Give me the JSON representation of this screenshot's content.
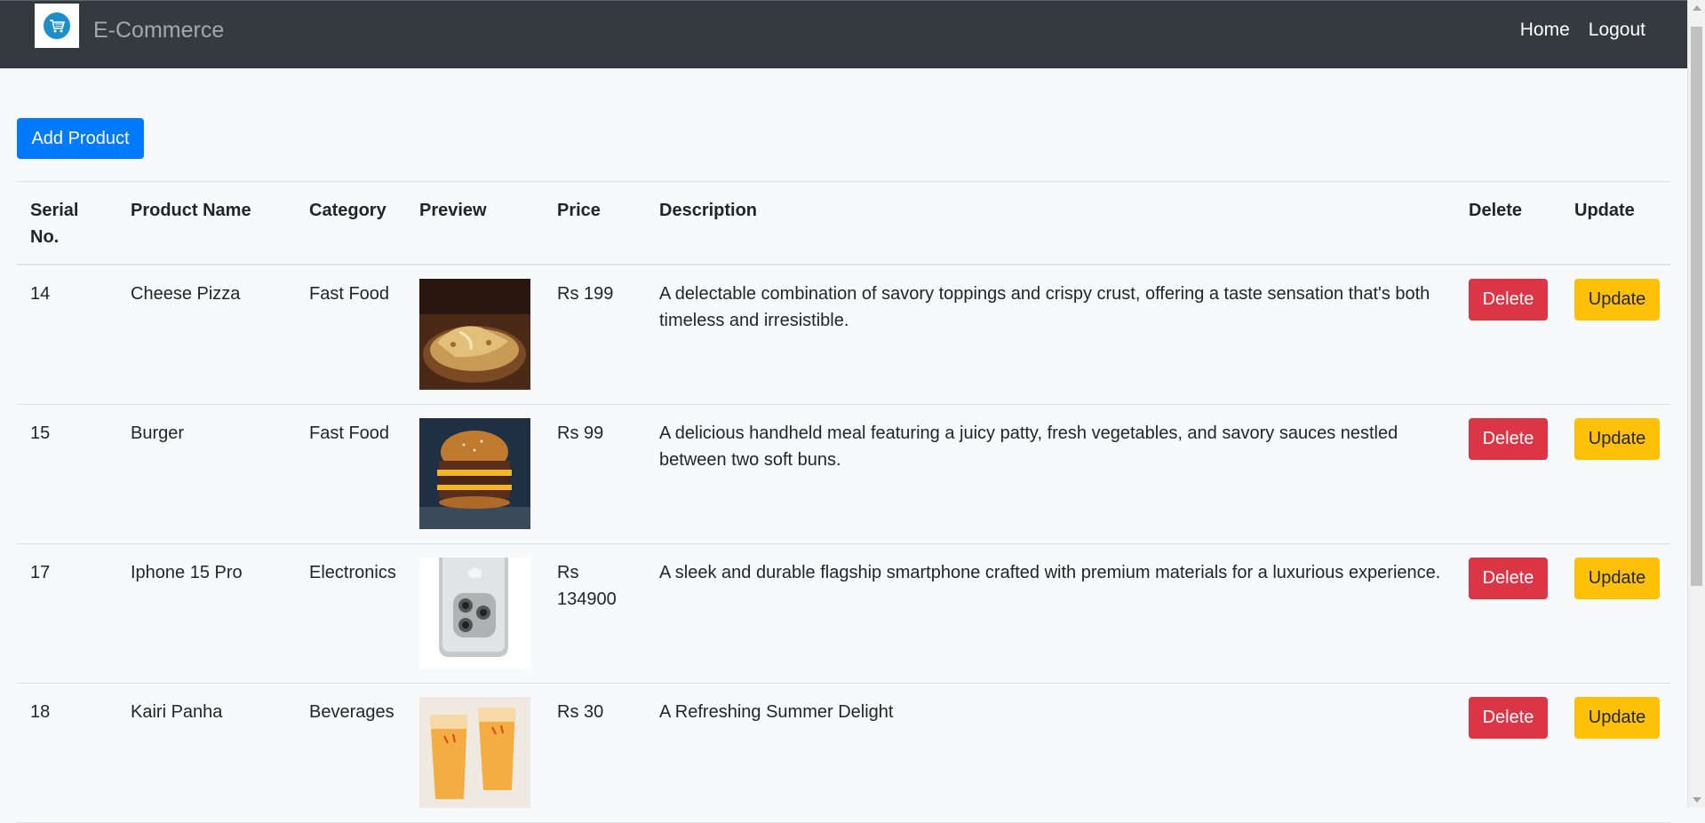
{
  "navbar": {
    "brand": "E-Commerce",
    "links": {
      "home": "Home",
      "logout": "Logout"
    }
  },
  "toolbar": {
    "add_label": "Add Product"
  },
  "table": {
    "headers": {
      "serial": "Serial No.",
      "name": "Product Name",
      "category": "Category",
      "preview": "Preview",
      "price": "Price",
      "description": "Description",
      "delete": "Delete",
      "update": "Update"
    },
    "rows": [
      {
        "serial": "14",
        "name": "Cheese Pizza",
        "category": "Fast Food",
        "preview_icon": "pizza-image",
        "price": "Rs 199",
        "description": "A delectable combination of savory toppings and crispy crust, offering a taste sensation that's both timeless and irresistible.",
        "delete_label": "Delete",
        "update_label": "Update"
      },
      {
        "serial": "15",
        "name": "Burger",
        "category": "Fast Food",
        "preview_icon": "burger-image",
        "price": "Rs 99",
        "description": "A delicious handheld meal featuring a juicy patty, fresh vegetables, and savory sauces nestled between two soft buns.",
        "delete_label": "Delete",
        "update_label": "Update"
      },
      {
        "serial": "17",
        "name": "Iphone 15 Pro",
        "category": "Electronics",
        "preview_icon": "phone-image",
        "price": "Rs 134900",
        "description": "A sleek and durable flagship smartphone crafted with premium materials for a luxurious experience.",
        "delete_label": "Delete",
        "update_label": "Update"
      },
      {
        "serial": "18",
        "name": "Kairi Panha",
        "category": "Beverages",
        "preview_icon": "drink-image",
        "price": "Rs 30",
        "description": "A Refreshing Summer Delight",
        "delete_label": "Delete",
        "update_label": "Update"
      }
    ]
  },
  "colors": {
    "navbar_bg": "#343a40",
    "primary": "#007bff",
    "danger": "#dc3545",
    "warning": "#ffc107"
  }
}
